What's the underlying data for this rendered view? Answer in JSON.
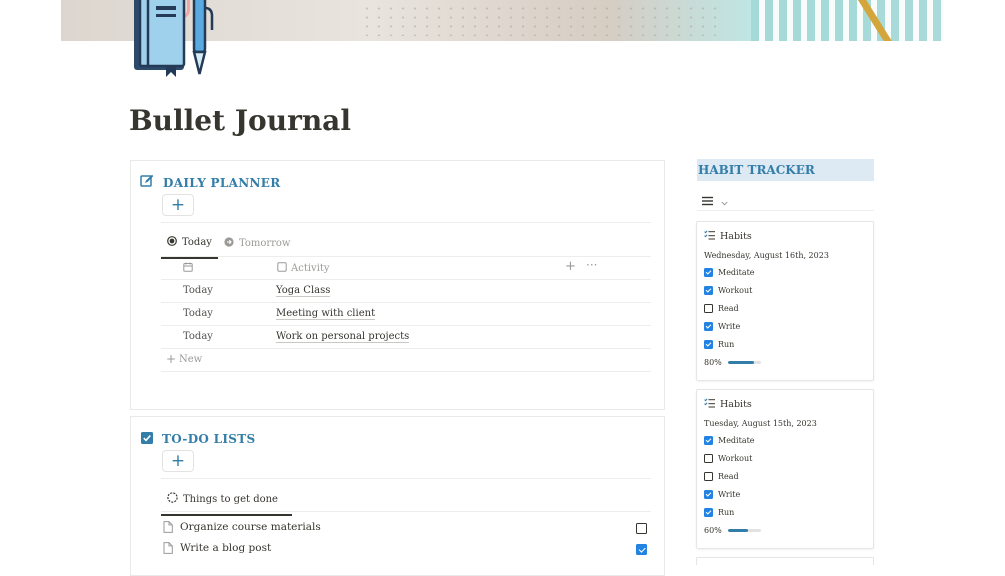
{
  "page": {
    "title": "Bullet Journal"
  },
  "daily_planner": {
    "title": "DAILY PLANNER",
    "add_label": "+",
    "tabs": [
      {
        "label": "Today",
        "active": true
      },
      {
        "label": "Tomorrow",
        "active": false
      }
    ],
    "columns": {
      "activity": "Activity"
    },
    "rows": [
      {
        "date": "Today",
        "activity": "Yoga Class"
      },
      {
        "date": "Today",
        "activity": "Meeting with client"
      },
      {
        "date": "Today",
        "activity": "Work on personal projects"
      }
    ],
    "new_label": "New"
  },
  "todo": {
    "title": "TO-DO LISTS",
    "add_label": "+",
    "tab": "Things to get done",
    "items": [
      {
        "label": "Organize course materials",
        "done": false
      },
      {
        "label": "Write a blog post",
        "done": true
      }
    ]
  },
  "habit_tracker": {
    "title": "HABIT TRACKER",
    "cards": [
      {
        "heading": "Habits",
        "date": "Wednesday, August 16th, 2023",
        "habits": [
          {
            "label": "Meditate",
            "done": true
          },
          {
            "label": "Workout",
            "done": true
          },
          {
            "label": "Read",
            "done": false
          },
          {
            "label": "Write",
            "done": true
          },
          {
            "label": "Run",
            "done": true
          }
        ],
        "progress_label": "80%",
        "progress": 0.8
      },
      {
        "heading": "Habits",
        "date": "Tuesday, August 15th, 2023",
        "habits": [
          {
            "label": "Meditate",
            "done": true
          },
          {
            "label": "Workout",
            "done": false
          },
          {
            "label": "Read",
            "done": false
          },
          {
            "label": "Write",
            "done": true
          },
          {
            "label": "Run",
            "done": true
          }
        ],
        "progress_label": "60%",
        "progress": 0.6
      }
    ]
  },
  "colors": {
    "accent": "#337ea9",
    "checkbox": "#2383e2",
    "text": "#37352f",
    "muted": "#9b9a97",
    "habit_header_bg": "#dde9f3"
  },
  "icons": {
    "page_icon": "notebook-pen-icon",
    "daily_planner": "edit-note-icon",
    "todo": "checked-box-icon",
    "today_tab": "target-circle-icon",
    "tomorrow_tab": "arrow-circle-icon",
    "date_column": "calendar-icon",
    "activity_column": "checkbox-icon",
    "add": "plus-icon",
    "more": "more-dots-icon",
    "todo_tab": "loading-circle-icon",
    "todo_item": "page-icon",
    "habit_view": "list-icon",
    "habit_card": "checklist-icon"
  }
}
